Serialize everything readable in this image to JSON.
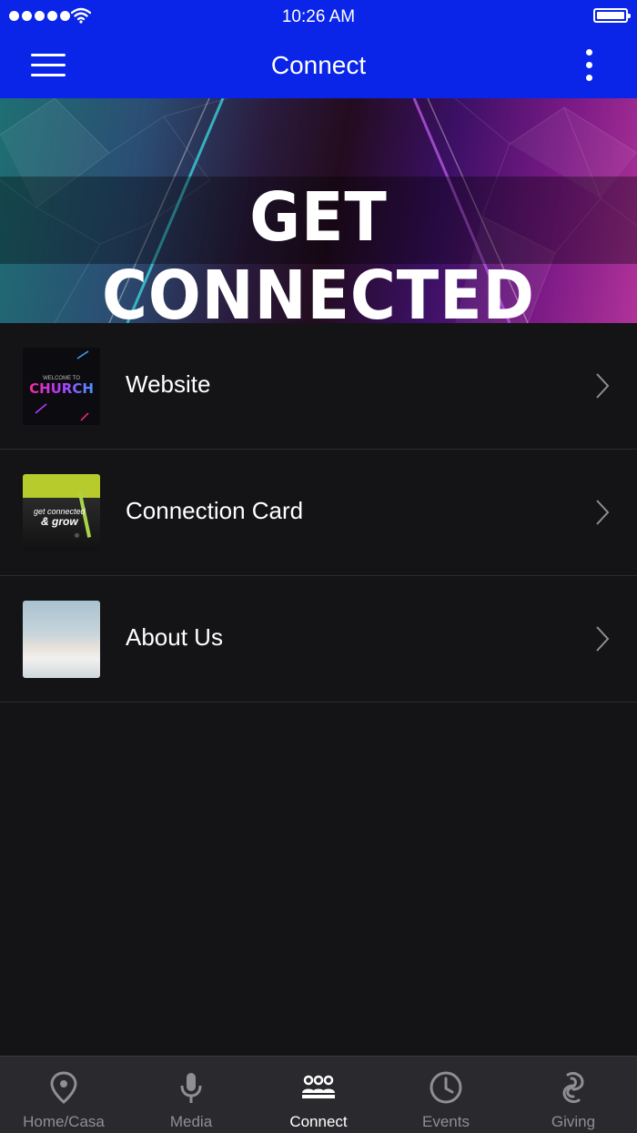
{
  "status_bar": {
    "time": "10:26 AM",
    "signal_dots": 5,
    "icons": [
      "signal-dots-icon",
      "wifi-icon",
      "battery-icon"
    ]
  },
  "nav": {
    "title": "Connect",
    "left_icon": "menu-icon",
    "right_icon": "more-vertical-icon",
    "bg_color": "#0a25e8"
  },
  "banner": {
    "text": "GET CONNECTED"
  },
  "list": {
    "items": [
      {
        "label": "Website",
        "thumb_caption": "WELCOME TO",
        "thumb_title": "CHURCH",
        "icon": "chevron-right-icon"
      },
      {
        "label": "Connection Card",
        "thumb_line1": "get connected",
        "thumb_line2": "& grow",
        "icon": "chevron-right-icon"
      },
      {
        "label": "About Us",
        "icon": "chevron-right-icon"
      }
    ]
  },
  "tab_bar": {
    "tabs": [
      {
        "label": "Home/Casa",
        "icon": "location-pin-icon",
        "active": false
      },
      {
        "label": "Media",
        "icon": "microphone-icon",
        "active": false
      },
      {
        "label": "Connect",
        "icon": "group-icon",
        "active": true
      },
      {
        "label": "Events",
        "icon": "clock-icon",
        "active": false
      },
      {
        "label": "Giving",
        "icon": "giving-icon",
        "active": false
      }
    ]
  },
  "colors": {
    "background": "#141416",
    "tab_bar": "#2a2a2e",
    "inactive_tab": "#8e8e93",
    "active_tab": "#ffffff"
  }
}
